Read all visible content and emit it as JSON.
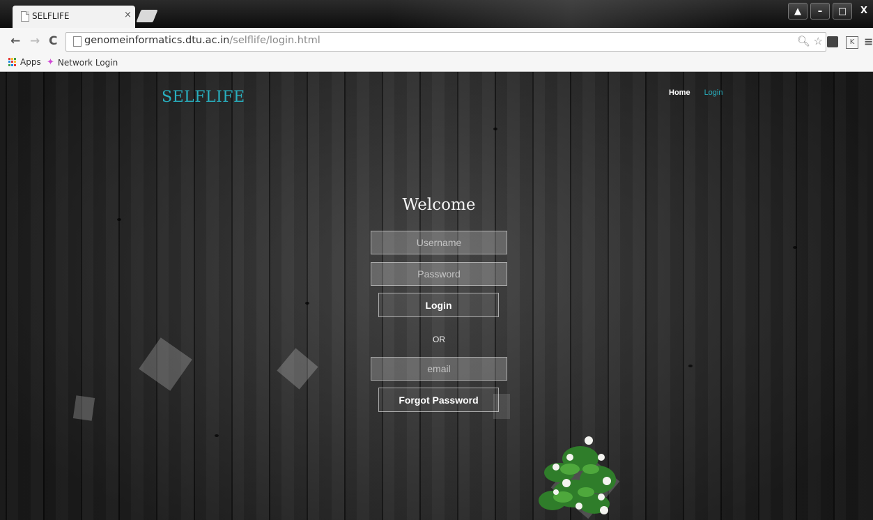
{
  "browser": {
    "tab_title": "SELFLIFE",
    "tab_close": "×",
    "url_host": "genomeinformatics.dtu.ac.in",
    "url_path": "/selflife/login.html",
    "bookmarks": [
      {
        "label": "Apps"
      },
      {
        "label": "Network Login"
      }
    ],
    "nav": {
      "back": "←",
      "forward": "→",
      "reload": "C"
    },
    "window_controls": {
      "minimize": "–",
      "maximize": "□",
      "close": "X"
    }
  },
  "site": {
    "logo": "SELFLIFE",
    "nav": {
      "home": "Home",
      "login": "Login"
    },
    "accent_color": "#28b0c0"
  },
  "login_form": {
    "heading": "Welcome",
    "username_placeholder": "Username",
    "password_placeholder": "Password",
    "login_button": "Login",
    "or_text": "OR",
    "email_placeholder": "email",
    "forgot_button": "Forgot Password"
  }
}
